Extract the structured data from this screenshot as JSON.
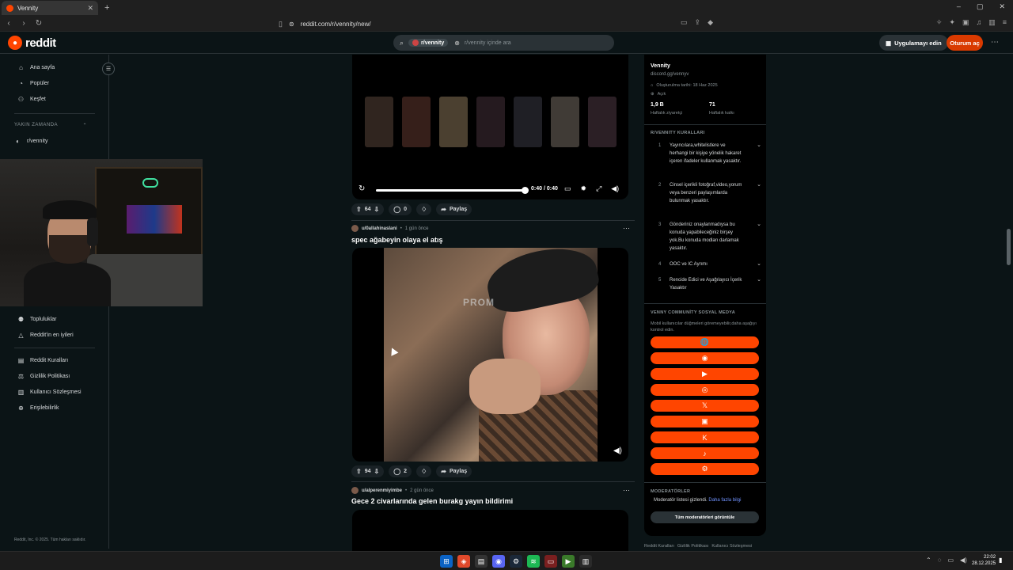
{
  "browser": {
    "tab_title": "Vennity",
    "url": "reddit.com/r/vennity/new/",
    "win_min": "–",
    "win_max": "▢",
    "win_close": "✕",
    "new_tab": "+",
    "tab_close": "✕"
  },
  "header": {
    "logo_text": "reddit",
    "search_chip": "r/vennity",
    "search_placeholder": "r/vennity içinde ara",
    "app_button": "Uygulamayı edin",
    "login_button": "Oturum aç"
  },
  "leftnav": {
    "items": [
      {
        "label": "Ana sayfa",
        "icon": "home-icon"
      },
      {
        "label": "Popüler",
        "icon": "popular-icon"
      },
      {
        "label": "Keşfet",
        "icon": "explore-icon"
      }
    ],
    "recent_title": "YAKIN ZAMANDA",
    "recent_items": [
      "r/vennity"
    ],
    "resource_items": [
      {
        "label": "Topluluklar",
        "icon": "communities-icon"
      },
      {
        "label": "Reddit'in en iyileri",
        "icon": "best-of-icon"
      }
    ],
    "policy_items": [
      {
        "label": "Reddit Kuralları",
        "icon": "rules-icon"
      },
      {
        "label": "Gizlilik Politikası",
        "icon": "privacy-icon"
      },
      {
        "label": "Kullanıcı Sözleşmesi",
        "icon": "agreement-icon"
      },
      {
        "label": "Erişilebilirlik",
        "icon": "accessibility-icon"
      }
    ],
    "copyright": "Reddit, Inc. © 2025. Tüm hakları saklıdır."
  },
  "video1": {
    "time": "0:40 / 0:40",
    "progress": 1.0
  },
  "posts": [
    {
      "upvotes": "64",
      "comments": "0",
      "share": "Paylaş"
    },
    {
      "user": "u/0allahinaslani",
      "age": "1 gün önce",
      "title": "spec ağabeyin olaya el atış",
      "upvotes": "94",
      "comments": "2",
      "share": "Paylaş",
      "overlay_text": "PROM"
    },
    {
      "user": "u/alperenmiyimbe",
      "age": "2 gün önce",
      "title": "Gece 2 civarlarında gelen burakg yayın bildirimi"
    }
  ],
  "sidebar": {
    "name": "Vennity",
    "link": "discord.gg/vennyv",
    "created": "Oluşturulma tarihi: 18 Haz 2025",
    "visibility": "Açık",
    "stats": [
      {
        "value": "1,9 B",
        "label": "Haftalık ziyaretçi"
      },
      {
        "value": "71",
        "label": "Haftalık katkı"
      }
    ],
    "rules_title": "R/VENNITY KURALLARI",
    "rules": [
      {
        "num": "1",
        "text": "Yayıncılara,whitelistlere ve herhangi bir kişiye yönelik hakaret içeren ifadeler kullanmak yasaktır."
      },
      {
        "num": "2",
        "text": "Cinsel içerikli fotoğraf,video,yorum veya benzeri paylaşımlarda bulunmak yasaktır."
      },
      {
        "num": "3",
        "text": "Gönderiniz onaylanmadıysa bu konuda yapabileceğiniz birşey yok.Bu konuda modları darlamak yasaktır."
      },
      {
        "num": "4",
        "text": "OOC ve IC Ayrımı"
      },
      {
        "num": "5",
        "text": "Rencide Edici ve Aşağılayıcı İçerik Yasaktır"
      }
    ],
    "social_title": "VENNY COMMUNİTY SOSYAL MEDYA",
    "social_note": "Mobil kullanıcılar düğmeleri göremeyebilir,daha aşağıyı kontrol edin.",
    "social_buttons": [
      {
        "icon": "globe-icon",
        "glyph": "🌐"
      },
      {
        "icon": "discord-icon",
        "glyph": "◉"
      },
      {
        "icon": "youtube-icon",
        "glyph": "▶"
      },
      {
        "icon": "instagram-icon",
        "glyph": "◎"
      },
      {
        "icon": "x-icon",
        "glyph": "𝕏"
      },
      {
        "icon": "twitch-icon",
        "glyph": "▣"
      },
      {
        "icon": "kick-icon",
        "glyph": "K"
      },
      {
        "icon": "tiktok-icon",
        "glyph": "♪"
      },
      {
        "icon": "steam-icon",
        "glyph": "⚙"
      }
    ],
    "mods_title": "MODERATÖRLER",
    "mods_hidden": "Moderatör listesi gizlendi.",
    "mods_more": "Daha fazla bilgi",
    "mods_button": "Tüm moderatörleri görüntüle",
    "footer_links": [
      "Reddit Kuralları",
      "Gizlilik Politikası",
      "Kullanıcı Sözleşmesi"
    ]
  },
  "taskbar": {
    "time": "22:02",
    "date": "28.12.2025"
  },
  "colors": {
    "accent": "#ff4500",
    "login": "#d93a00",
    "background": "#0b1416"
  }
}
